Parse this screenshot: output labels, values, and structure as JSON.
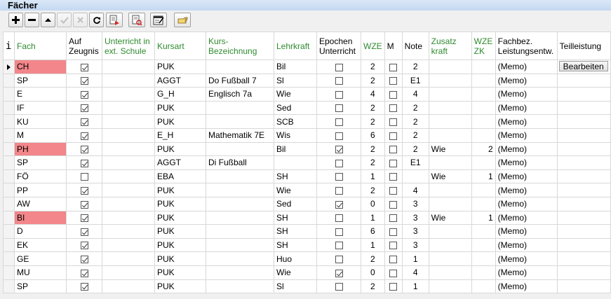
{
  "window": {
    "title": "Fächer"
  },
  "toolbar": {
    "buttons": [
      {
        "name": "add-button",
        "icon": "plus-icon",
        "enabled": true
      },
      {
        "name": "remove-button",
        "icon": "minus-icon",
        "enabled": true
      },
      {
        "name": "move-up-button",
        "icon": "triangle-up-icon",
        "enabled": true
      },
      {
        "name": "confirm-button",
        "icon": "check-icon",
        "enabled": false
      },
      {
        "name": "cancel-button",
        "icon": "x-icon",
        "enabled": false
      },
      {
        "name": "refresh-button",
        "icon": "refresh-icon",
        "enabled": true
      },
      {
        "name": "export-button",
        "icon": "document-arrow-icon",
        "enabled": true
      },
      {
        "name": "import-button",
        "icon": "document-search-icon",
        "enabled": true
      },
      {
        "name": "edit-form-button",
        "icon": "form-edit-icon",
        "enabled": true
      },
      {
        "name": "goto-button",
        "icon": "pointing-hand-icon",
        "enabled": true
      }
    ]
  },
  "grid": {
    "indicator_header": "i",
    "columns": [
      {
        "key": "fach",
        "label": "Fach",
        "green": true
      },
      {
        "key": "zeugnis",
        "label": "Auf Zeugnis",
        "green": false
      },
      {
        "key": "ext",
        "label": "Unterricht in ext. Schule",
        "green": true
      },
      {
        "key": "kursart",
        "label": "Kursart",
        "green": true
      },
      {
        "key": "bez",
        "label": "Kurs-Bezeichnung",
        "green": true
      },
      {
        "key": "lehr",
        "label": "Lehrkraft",
        "green": true
      },
      {
        "key": "epochen",
        "label": "Epochen Unterricht",
        "green": false
      },
      {
        "key": "wze",
        "label": "WZE",
        "green": true
      },
      {
        "key": "m",
        "label": "M",
        "green": false
      },
      {
        "key": "note",
        "label": "Note",
        "green": false
      },
      {
        "key": "zusatz",
        "label": "Zusatz kraft",
        "green": true
      },
      {
        "key": "wzezk",
        "label": "WZE ZK",
        "green": true
      },
      {
        "key": "fachbez",
        "label": "Fachbez. Leistungsentw.",
        "green": false
      },
      {
        "key": "teil",
        "label": "Teilleistung",
        "green": false
      }
    ],
    "button_label": "Bearbeiten",
    "highlight_color": "#f2868a",
    "rows": [
      {
        "fach": "CH",
        "hl": true,
        "zeugnis": true,
        "ext": "",
        "kursart": "PUK",
        "bez": "",
        "lehr": "Bil",
        "epochen": false,
        "wze": "2",
        "m": false,
        "note": "2",
        "zusatz": "",
        "wzezk": "",
        "fachbez": "(Memo)",
        "teil": "Bearbeiten",
        "current": true
      },
      {
        "fach": "SP",
        "hl": false,
        "zeugnis": true,
        "ext": "",
        "kursart": "AGGT",
        "bez": "Do Fußball 7",
        "lehr": "Sl",
        "epochen": false,
        "wze": "2",
        "m": false,
        "note": "E1",
        "zusatz": "",
        "wzezk": "",
        "fachbez": "(Memo)",
        "teil": ""
      },
      {
        "fach": "E",
        "hl": false,
        "zeugnis": true,
        "ext": "",
        "kursart": "G_H",
        "bez": "Englisch 7a",
        "lehr": "Wie",
        "epochen": false,
        "wze": "4",
        "m": false,
        "note": "4",
        "zusatz": "",
        "wzezk": "",
        "fachbez": "(Memo)",
        "teil": ""
      },
      {
        "fach": "IF",
        "hl": false,
        "zeugnis": true,
        "ext": "",
        "kursart": "PUK",
        "bez": "",
        "lehr": "Sed",
        "epochen": false,
        "wze": "2",
        "m": false,
        "note": "2",
        "zusatz": "",
        "wzezk": "",
        "fachbez": "(Memo)",
        "teil": ""
      },
      {
        "fach": "KU",
        "hl": false,
        "zeugnis": true,
        "ext": "",
        "kursart": "PUK",
        "bez": "",
        "lehr": "SCB",
        "epochen": false,
        "wze": "2",
        "m": false,
        "note": "2",
        "zusatz": "",
        "wzezk": "",
        "fachbez": "(Memo)",
        "teil": ""
      },
      {
        "fach": "M",
        "hl": false,
        "zeugnis": true,
        "ext": "",
        "kursart": "E_H",
        "bez": "Mathematik 7E",
        "lehr": "Wis",
        "epochen": false,
        "wze": "6",
        "m": false,
        "note": "2",
        "zusatz": "",
        "wzezk": "",
        "fachbez": "(Memo)",
        "teil": ""
      },
      {
        "fach": "PH",
        "hl": true,
        "zeugnis": true,
        "ext": "",
        "kursart": "PUK",
        "bez": "",
        "lehr": "Bil",
        "epochen": true,
        "wze": "2",
        "m": false,
        "note": "2",
        "zusatz": "Wie",
        "wzezk": "2",
        "fachbez": "(Memo)",
        "teil": ""
      },
      {
        "fach": "SP",
        "hl": false,
        "zeugnis": true,
        "ext": "",
        "kursart": "AGGT",
        "bez": "Di Fußball",
        "lehr": "",
        "epochen": false,
        "wze": "2",
        "m": false,
        "note": "E1",
        "zusatz": "",
        "wzezk": "",
        "fachbez": "(Memo)",
        "teil": ""
      },
      {
        "fach": "FÖ",
        "hl": false,
        "zeugnis": false,
        "ext": "",
        "kursart": "EBA",
        "bez": "",
        "lehr": "SH",
        "epochen": false,
        "wze": "1",
        "m": false,
        "note": "",
        "zusatz": "Wie",
        "wzezk": "1",
        "fachbez": "(Memo)",
        "teil": ""
      },
      {
        "fach": "PP",
        "hl": false,
        "zeugnis": true,
        "ext": "",
        "kursart": "PUK",
        "bez": "",
        "lehr": "Wie",
        "epochen": false,
        "wze": "2",
        "m": false,
        "note": "4",
        "zusatz": "",
        "wzezk": "",
        "fachbez": "(Memo)",
        "teil": ""
      },
      {
        "fach": "AW",
        "hl": false,
        "zeugnis": true,
        "ext": "",
        "kursart": "PUK",
        "bez": "",
        "lehr": "Sed",
        "epochen": true,
        "wze": "0",
        "m": false,
        "note": "3",
        "zusatz": "",
        "wzezk": "",
        "fachbez": "(Memo)",
        "teil": ""
      },
      {
        "fach": "BI",
        "hl": true,
        "zeugnis": true,
        "ext": "",
        "kursart": "PUK",
        "bez": "",
        "lehr": "SH",
        "epochen": false,
        "wze": "1",
        "m": false,
        "note": "3",
        "zusatz": "Wie",
        "wzezk": "1",
        "fachbez": "(Memo)",
        "teil": ""
      },
      {
        "fach": "D",
        "hl": false,
        "zeugnis": true,
        "ext": "",
        "kursart": "PUK",
        "bez": "",
        "lehr": "SH",
        "epochen": false,
        "wze": "6",
        "m": false,
        "note": "3",
        "zusatz": "",
        "wzezk": "",
        "fachbez": "(Memo)",
        "teil": ""
      },
      {
        "fach": "EK",
        "hl": false,
        "zeugnis": true,
        "ext": "",
        "kursart": "PUK",
        "bez": "",
        "lehr": "SH",
        "epochen": false,
        "wze": "1",
        "m": false,
        "note": "3",
        "zusatz": "",
        "wzezk": "",
        "fachbez": "(Memo)",
        "teil": ""
      },
      {
        "fach": "GE",
        "hl": false,
        "zeugnis": true,
        "ext": "",
        "kursart": "PUK",
        "bez": "",
        "lehr": "Huo",
        "epochen": false,
        "wze": "2",
        "m": false,
        "note": "1",
        "zusatz": "",
        "wzezk": "",
        "fachbez": "(Memo)",
        "teil": ""
      },
      {
        "fach": "MU",
        "hl": false,
        "zeugnis": true,
        "ext": "",
        "kursart": "PUK",
        "bez": "",
        "lehr": "Wie",
        "epochen": true,
        "wze": "0",
        "m": false,
        "note": "4",
        "zusatz": "",
        "wzezk": "",
        "fachbez": "(Memo)",
        "teil": ""
      },
      {
        "fach": "SP",
        "hl": false,
        "zeugnis": true,
        "ext": "",
        "kursart": "PUK",
        "bez": "",
        "lehr": "Sl",
        "epochen": false,
        "wze": "2",
        "m": false,
        "note": "1",
        "zusatz": "",
        "wzezk": "",
        "fachbez": "(Memo)",
        "teil": ""
      }
    ]
  }
}
